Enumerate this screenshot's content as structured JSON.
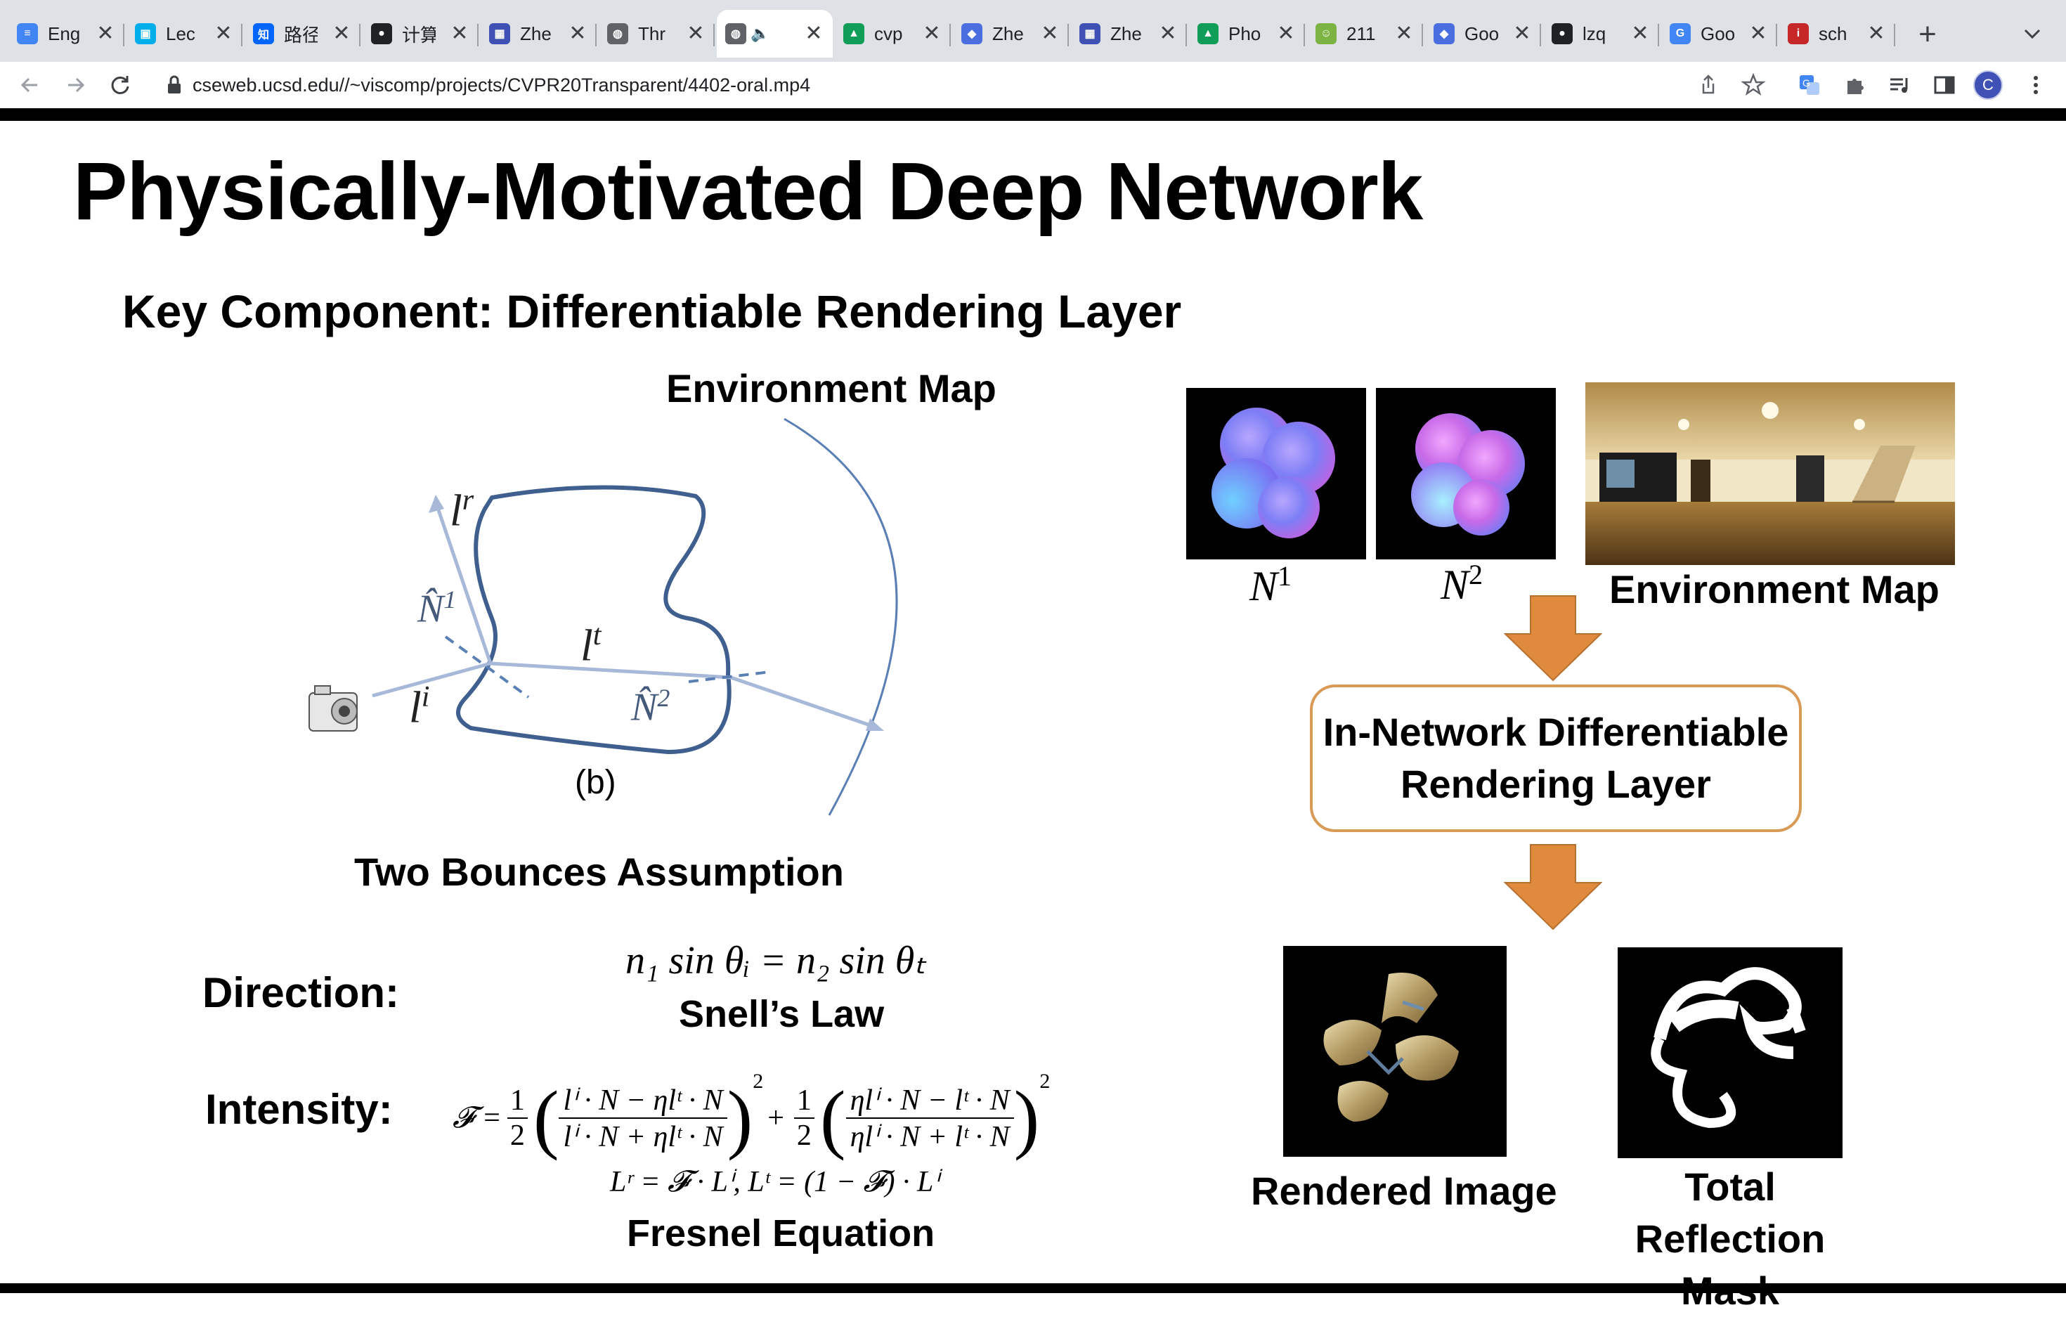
{
  "browser": {
    "tabs": [
      {
        "title": "Eng",
        "favicon_color": "#4285f4",
        "favicon_glyph": "≡",
        "active": false
      },
      {
        "title": "Lec",
        "favicon_color": "#00aeec",
        "favicon_glyph": "▣",
        "active": false
      },
      {
        "title": "路径",
        "favicon_color": "#0066ff",
        "favicon_glyph": "知",
        "active": false
      },
      {
        "title": "计算",
        "favicon_color": "#202124",
        "favicon_glyph": "●",
        "active": false
      },
      {
        "title": "Zhe",
        "favicon_color": "#3f51b5",
        "favicon_glyph": "▦",
        "active": false
      },
      {
        "title": "Thr",
        "favicon_color": "#5f6368",
        "favicon_glyph": "◍",
        "active": false
      },
      {
        "title": "",
        "favicon_color": "#5f6368",
        "favicon_glyph": "◍",
        "active": true,
        "audio": "🔈"
      },
      {
        "title": "cvp",
        "favicon_color": "#0f9d58",
        "favicon_glyph": "▲",
        "active": false
      },
      {
        "title": "Zhe",
        "favicon_color": "#4a6ee0",
        "favicon_glyph": "◆",
        "active": false
      },
      {
        "title": "Zhe",
        "favicon_color": "#3f51b5",
        "favicon_glyph": "▦",
        "active": false
      },
      {
        "title": "Pho",
        "favicon_color": "#0f9d58",
        "favicon_glyph": "▲",
        "active": false
      },
      {
        "title": "211",
        "favicon_color": "#7cb342",
        "favicon_glyph": "☺",
        "active": false
      },
      {
        "title": "Goo",
        "favicon_color": "#4a6ee0",
        "favicon_glyph": "◆",
        "active": false
      },
      {
        "title": "lzq",
        "favicon_color": "#202124",
        "favicon_glyph": "●",
        "active": false
      },
      {
        "title": "Goo",
        "favicon_color": "#4285f4",
        "favicon_glyph": "G",
        "active": false
      },
      {
        "title": "sch",
        "favicon_color": "#c62828",
        "favicon_glyph": "i",
        "active": false
      }
    ],
    "close_glyph": "✕",
    "new_tab_glyph": "+",
    "url": "cseweb.ucsd.edu//~viscomp/projects/CVPR20Transparent/4402-oral.mp4",
    "profile_initial": "C",
    "profile_color": "#3f51b5"
  },
  "slide": {
    "title": "Physically-Motivated Deep Network",
    "subtitle": "Key Component: Differentiable Rendering Layer",
    "diagram": {
      "env_map_label": "Environment Map",
      "lr_base": "l",
      "lr_sup": "r",
      "lt_base": "l",
      "lt_sup": "t",
      "li_base": "l",
      "li_sup": "i",
      "n1_base": "N̂",
      "n1_sup": "1",
      "n2_base": "N̂",
      "n2_sup": "2",
      "caption": "(b)",
      "assumption": "Two Bounces Assumption"
    },
    "direction": {
      "label": "Direction:",
      "equation": "n₁ sin θᵢ = n₂ sin θₜ",
      "law": "Snell’s Law"
    },
    "intensity": {
      "label": "Intensity:",
      "equation_line1": "𝓕 = ½ ( (lⁱ·N − ηlᵗ·N) / (lⁱ·N + ηlᵗ·N) )² + ½ ( (ηlⁱ·N − lᵗ·N) / (ηlⁱ·N + lᵗ·N) )²",
      "f_sym": "𝓕 =",
      "half": "1",
      "two": "2",
      "frac1_num": "lⁱ · N − ηlᵗ · N",
      "frac1_den": "lⁱ · N + ηlᵗ · N",
      "frac2_num": "ηlⁱ · N − lᵗ · N",
      "frac2_den": "ηlⁱ · N + lᵗ · N",
      "plus": "+",
      "exponent": "2",
      "equation_line2": "Lʳ = 𝓕 · Lⁱ,      Lᵗ = (1 − 𝓕) · Lⁱ",
      "law": "Fresnel Equation"
    },
    "pipeline": {
      "n1_base": "N",
      "n1_sup": "1",
      "n2_base": "N",
      "n2_sup": "2",
      "env_label": "Environment Map",
      "box_line1": "In-Network Differentiable",
      "box_line2": "Rendering Layer",
      "rendered_label": "Rendered Image",
      "mask_label_line1": "Total Reflection",
      "mask_label_line2": "Mask",
      "arrow_color": "#df8a3d",
      "box_border_color": "#d89a55"
    }
  }
}
